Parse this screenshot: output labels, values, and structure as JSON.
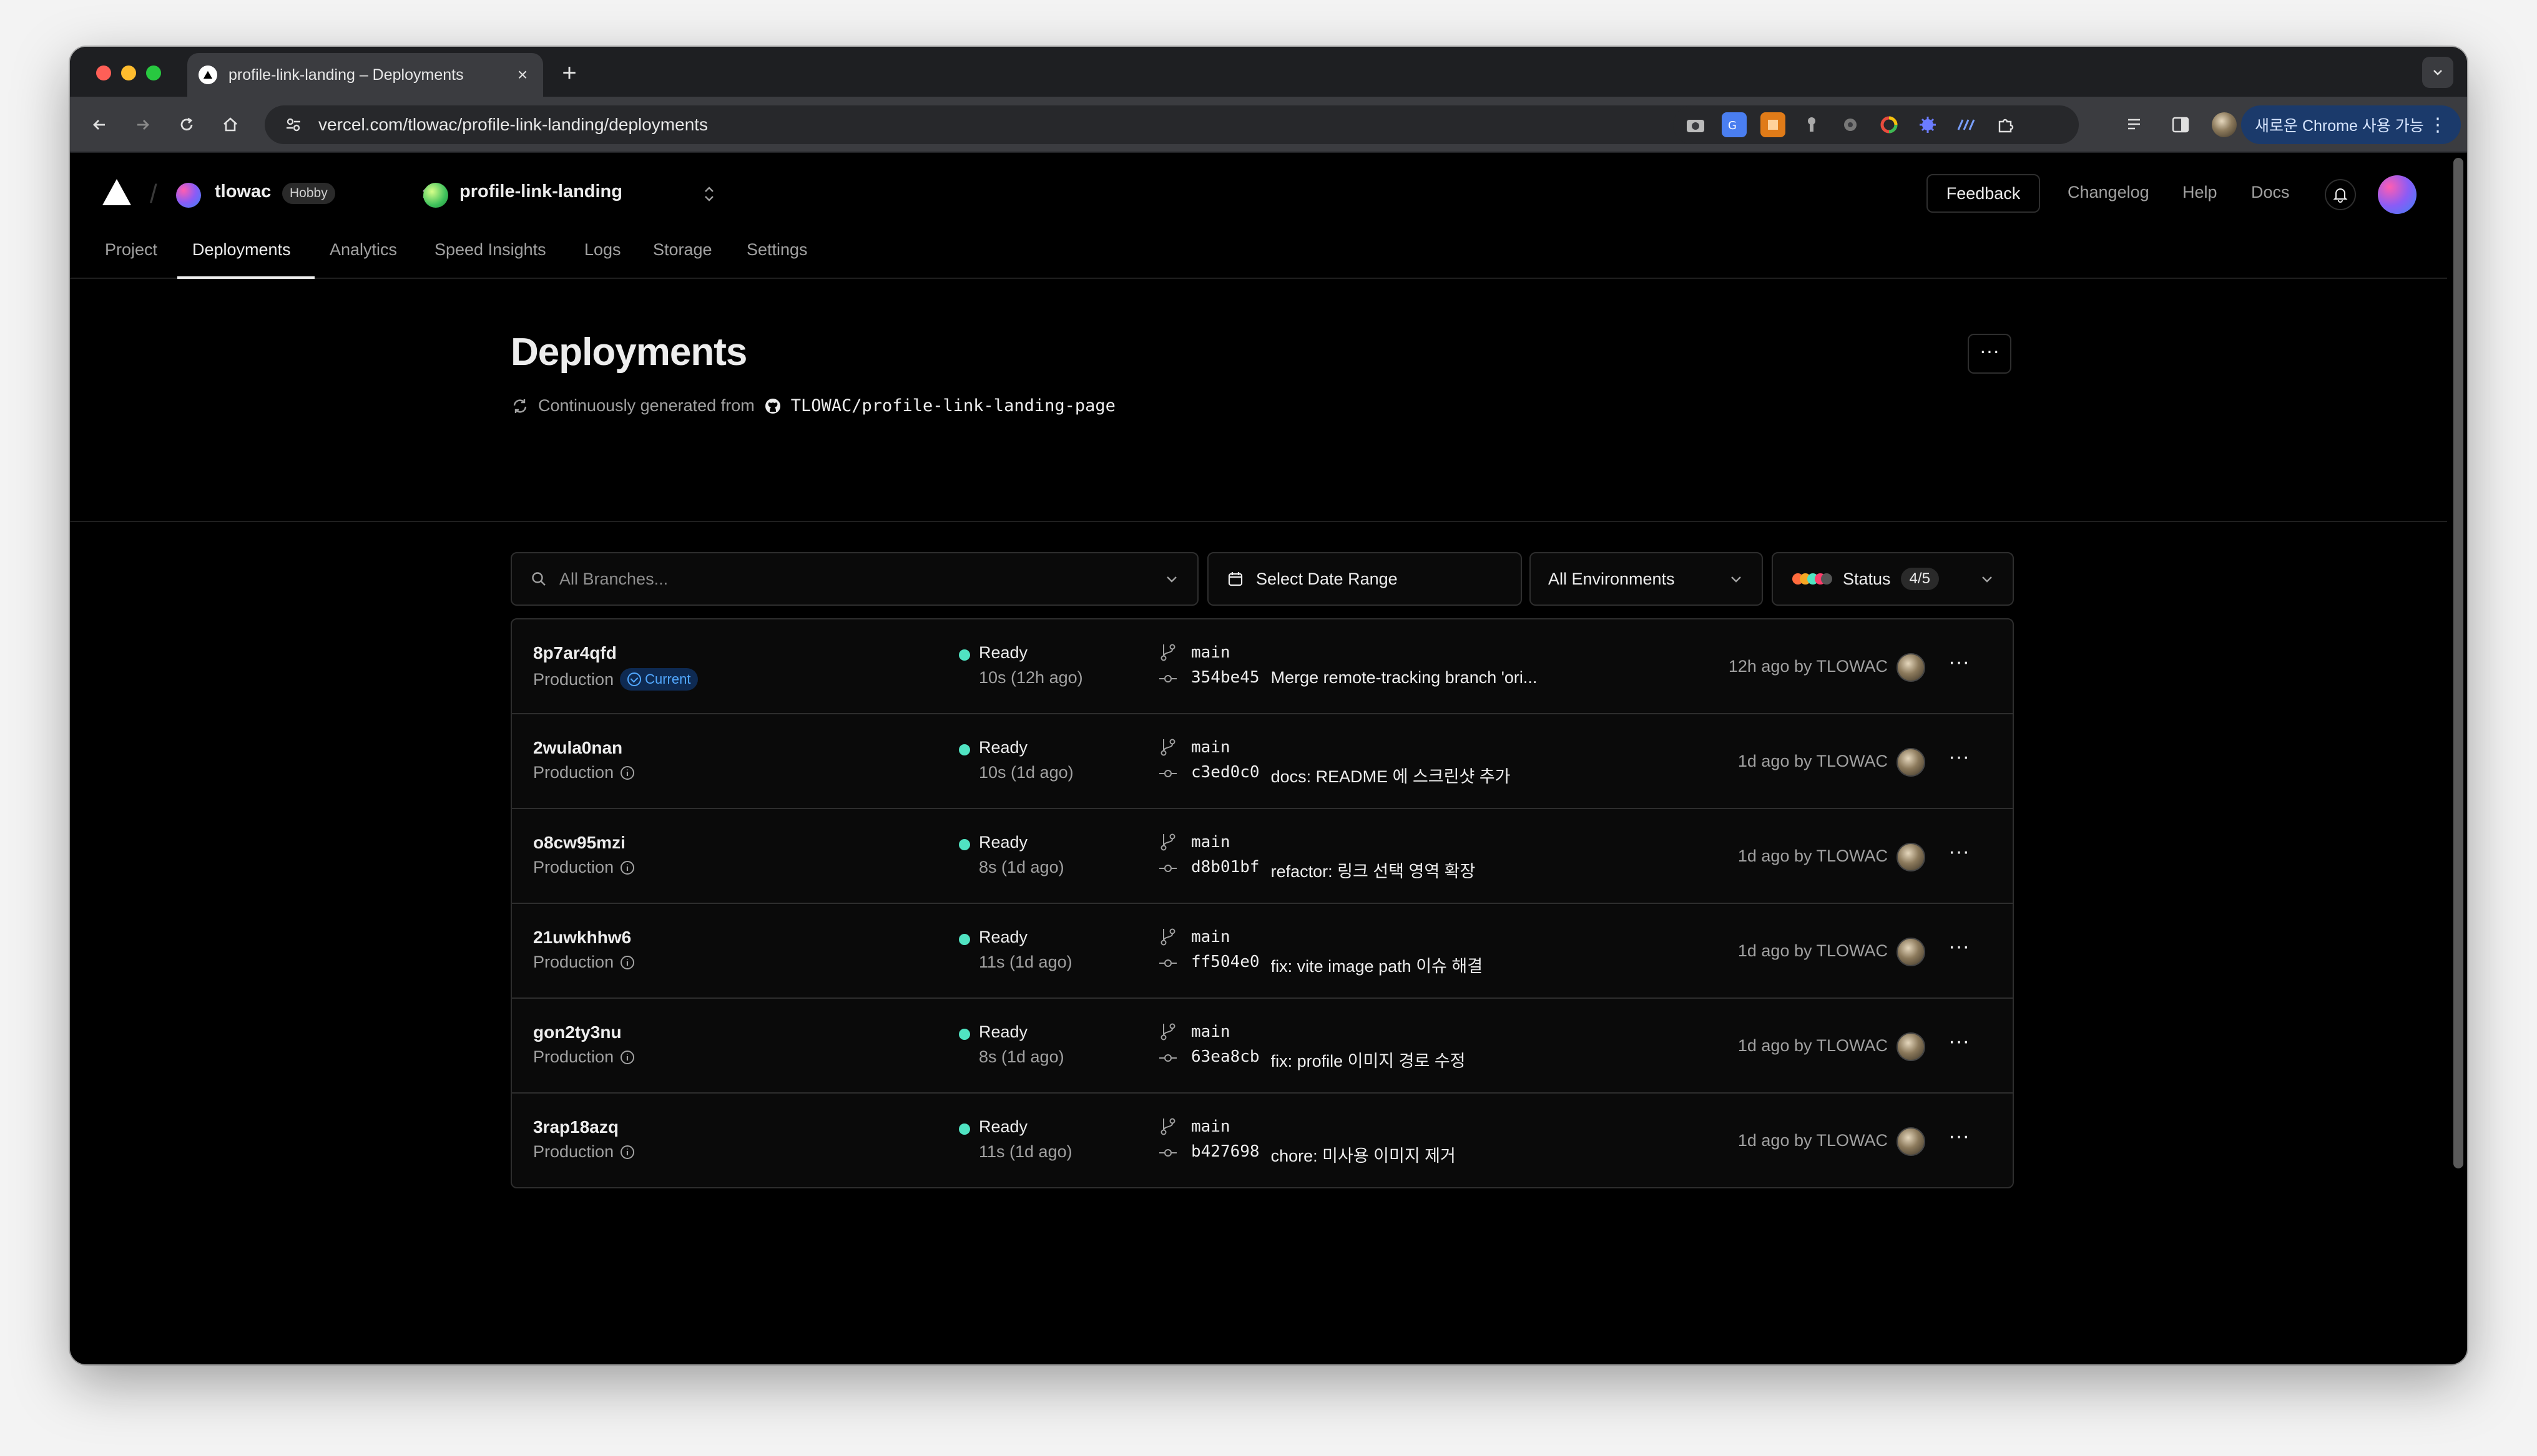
{
  "browser": {
    "tab_title": "profile-link-landing – Deployments",
    "url": "vercel.com/tlowac/profile-link-landing/deployments",
    "chrome_pill": "새로운 Chrome 사용 가능",
    "extensions": [
      "camera-ext-icon",
      "translate-ext-icon",
      "orange-ext-icon",
      "pin-ext-icon",
      "gear-ext-icon",
      "color-ring-ext-icon",
      "puzzle-blue-ext-icon",
      "wave-ext-icon"
    ]
  },
  "header": {
    "team_name": "tlowac",
    "team_plan": "Hobby",
    "project_name": "profile-link-landing",
    "feedback_label": "Feedback",
    "changelog_label": "Changelog",
    "help_label": "Help",
    "docs_label": "Docs"
  },
  "subnav": [
    "Project",
    "Deployments",
    "Analytics",
    "Speed Insights",
    "Logs",
    "Storage",
    "Settings"
  ],
  "main": {
    "title": "Deployments",
    "source_prefix": "Continuously generated from",
    "repo": "TLOWAC/profile-link-landing-page",
    "more_label": "···"
  },
  "filters": {
    "branches_placeholder": "All Branches...",
    "date_range": "Select Date Range",
    "environments": "All Environments",
    "status_label": "Status",
    "status_count": "4/5"
  },
  "deployments": [
    {
      "id": "8p7ar4qfd",
      "env": "Production",
      "current": "Current",
      "status": "Ready",
      "duration": "10s (12h ago)",
      "branch": "main",
      "sha": "354be45",
      "message": "Merge remote-tracking branch 'ori...",
      "meta": "12h ago by TLOWAC"
    },
    {
      "id": "2wula0nan",
      "env": "Production",
      "current": "",
      "status": "Ready",
      "duration": "10s (1d ago)",
      "branch": "main",
      "sha": "c3ed0c0",
      "message": "docs: README 에 스크린샷 추가",
      "meta": "1d ago by TLOWAC"
    },
    {
      "id": "o8cw95mzi",
      "env": "Production",
      "current": "",
      "status": "Ready",
      "duration": "8s (1d ago)",
      "branch": "main",
      "sha": "d8b01bf",
      "message": "refactor: 링크 선택 영역 확장",
      "meta": "1d ago by TLOWAC"
    },
    {
      "id": "21uwkhhw6",
      "env": "Production",
      "current": "",
      "status": "Ready",
      "duration": "11s (1d ago)",
      "branch": "main",
      "sha": "ff504e0",
      "message": "fix: vite image path 이슈 해결",
      "meta": "1d ago by TLOWAC"
    },
    {
      "id": "gon2ty3nu",
      "env": "Production",
      "current": "",
      "status": "Ready",
      "duration": "8s (1d ago)",
      "branch": "main",
      "sha": "63ea8cb",
      "message": "fix: profile 이미지 경로 수정",
      "meta": "1d ago by TLOWAC"
    },
    {
      "id": "3rap18azq",
      "env": "Production",
      "current": "",
      "status": "Ready",
      "duration": "11s (1d ago)",
      "branch": "main",
      "sha": "b427698",
      "message": "chore: 미사용 이미지 제거",
      "meta": "1d ago by TLOWAC"
    }
  ],
  "colors": {
    "ready": "#50e3c2",
    "current_badge_text": "#52a8ff",
    "background": "#000000",
    "border": "#2e2e2e"
  }
}
